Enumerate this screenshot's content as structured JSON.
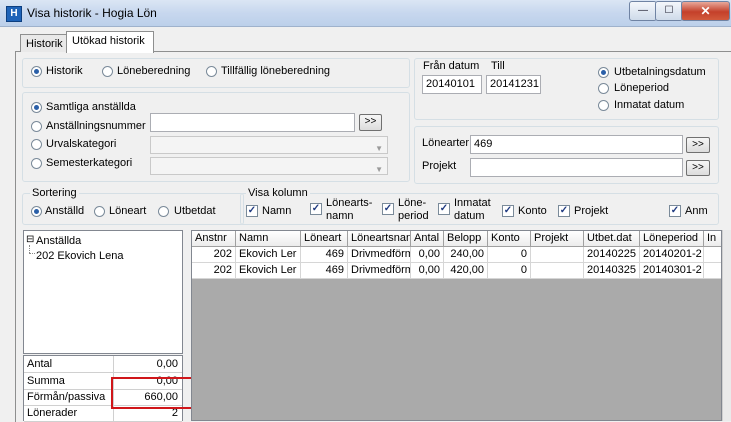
{
  "window": {
    "title": "Visa historik - Hogia Lön",
    "icon_letter": "H",
    "min_glyph": "—",
    "max_glyph": "☐",
    "close_glyph": "✕"
  },
  "tabs": {
    "historik": "Historik",
    "utokad": "Utökad historik"
  },
  "mode": {
    "options": [
      "Historik",
      "Löneberedning",
      "Tillfällig löneberedning"
    ],
    "selected": 0
  },
  "employees": {
    "options": [
      "Samtliga anställda",
      "Anställningsnummer",
      "Urvalskategori",
      "Semesterkategori"
    ],
    "selected": 0,
    "anstnr_value": "",
    "more_btn": ">>"
  },
  "dates": {
    "from_label": "Från datum",
    "to_label": "Till",
    "from": "20140101",
    "to": "20141231",
    "type_options": [
      "Utbetalningsdatum",
      "Löneperiod",
      "Inmatat datum"
    ],
    "type_selected": 0
  },
  "filters": {
    "lonearter_label": "Lönearter",
    "lonearter_value": "469",
    "projekt_label": "Projekt",
    "projekt_value": "",
    "btn": ">>"
  },
  "sorting": {
    "label": "Sortering",
    "options": [
      "Anställd",
      "Löneart",
      "Utbetdat"
    ],
    "selected": 0
  },
  "columns": {
    "label": "Visa kolumn",
    "namn": "Namn",
    "lonearts1": "Lönearts-",
    "lonearts2": "namn",
    "lone1": "Löne-",
    "lone2": "period",
    "inmatat1": "Inmatat",
    "inmatat2": "datum",
    "konto": "Konto",
    "projekt": "Projekt",
    "anm": "Anm",
    "check": "✓"
  },
  "tree": {
    "root": "Anställda",
    "root_glyph": "⊟",
    "child": "202 Ekovich Lena"
  },
  "summary": [
    {
      "label": "Antal",
      "value": "0,00"
    },
    {
      "label": "Summa",
      "value": "0,00"
    },
    {
      "label": "Förmån/passiva",
      "value": "660,00"
    },
    {
      "label": "Lönerader",
      "value": "2"
    }
  ],
  "grid": {
    "headers": [
      "Anstnr",
      "Namn",
      "Löneart",
      "Löneartsnan",
      "Antal",
      "Belopp",
      "Konto",
      "Projekt",
      "Utbet.dat",
      "Löneperiod",
      "In"
    ],
    "rows": [
      [
        "202",
        "Ekovich Ler",
        "469",
        "Drivmedförm",
        "0,00",
        "240,00",
        "0",
        "",
        "20140225",
        "20140201-2",
        ""
      ],
      [
        "202",
        "Ekovich Ler",
        "469",
        "Drivmedförm",
        "0,00",
        "420,00",
        "0",
        "",
        "20140325",
        "20140301-2",
        ""
      ]
    ]
  }
}
